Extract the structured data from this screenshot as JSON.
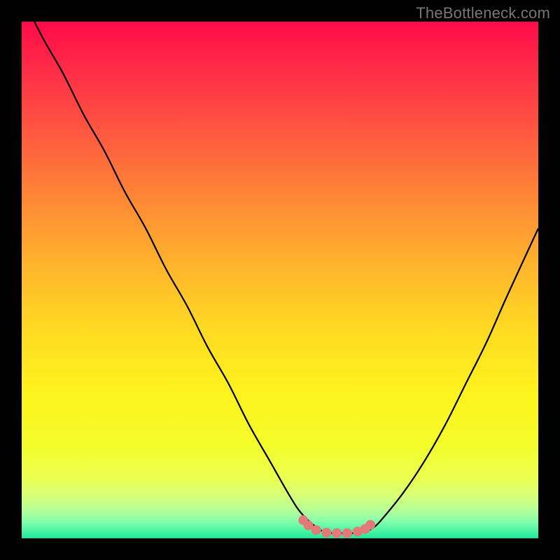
{
  "watermark": "TheBottleneck.com",
  "chart_data": {
    "type": "line",
    "title": "",
    "xlabel": "",
    "ylabel": "",
    "xlim": [
      0,
      100
    ],
    "ylim": [
      0,
      100
    ],
    "series": [
      {
        "name": "bottleneck-curve",
        "x": [
          0,
          4,
          8,
          12,
          16,
          20,
          24,
          28,
          32,
          36,
          40,
          44,
          48,
          52,
          54,
          56,
          58,
          60,
          62,
          64,
          66,
          68,
          70,
          74,
          78,
          82,
          86,
          90,
          94,
          100
        ],
        "y": [
          105,
          97,
          90,
          82,
          75,
          67,
          60,
          52,
          45,
          37,
          30,
          22,
          15,
          8,
          5,
          3,
          1.5,
          1,
          1,
          1,
          1.2,
          2,
          4,
          9,
          15,
          22,
          30,
          38,
          47,
          60
        ]
      }
    ],
    "markers": {
      "name": "flat-zone-markers",
      "x": [
        54.5,
        55.5,
        57,
        59,
        61,
        63,
        65,
        66.5,
        67.5
      ],
      "y": [
        3.5,
        2.5,
        1.6,
        1.1,
        1.0,
        1.0,
        1.3,
        1.8,
        2.6
      ],
      "color": "#e37a7a",
      "radius": 7
    },
    "gradient_stops": [
      {
        "pos": 0.0,
        "color": "#ff0b4a"
      },
      {
        "pos": 0.1,
        "color": "#ff2f47"
      },
      {
        "pos": 0.22,
        "color": "#ff5a3f"
      },
      {
        "pos": 0.35,
        "color": "#ff8a35"
      },
      {
        "pos": 0.48,
        "color": "#ffb72c"
      },
      {
        "pos": 0.6,
        "color": "#ffdb22"
      },
      {
        "pos": 0.72,
        "color": "#fdf31e"
      },
      {
        "pos": 0.82,
        "color": "#f4fc2a"
      },
      {
        "pos": 0.885,
        "color": "#eaff50"
      },
      {
        "pos": 0.918,
        "color": "#d6ff78"
      },
      {
        "pos": 0.945,
        "color": "#b5ff97"
      },
      {
        "pos": 0.965,
        "color": "#8cffab"
      },
      {
        "pos": 0.982,
        "color": "#55f7a6"
      },
      {
        "pos": 1.0,
        "color": "#1de89a"
      }
    ]
  }
}
